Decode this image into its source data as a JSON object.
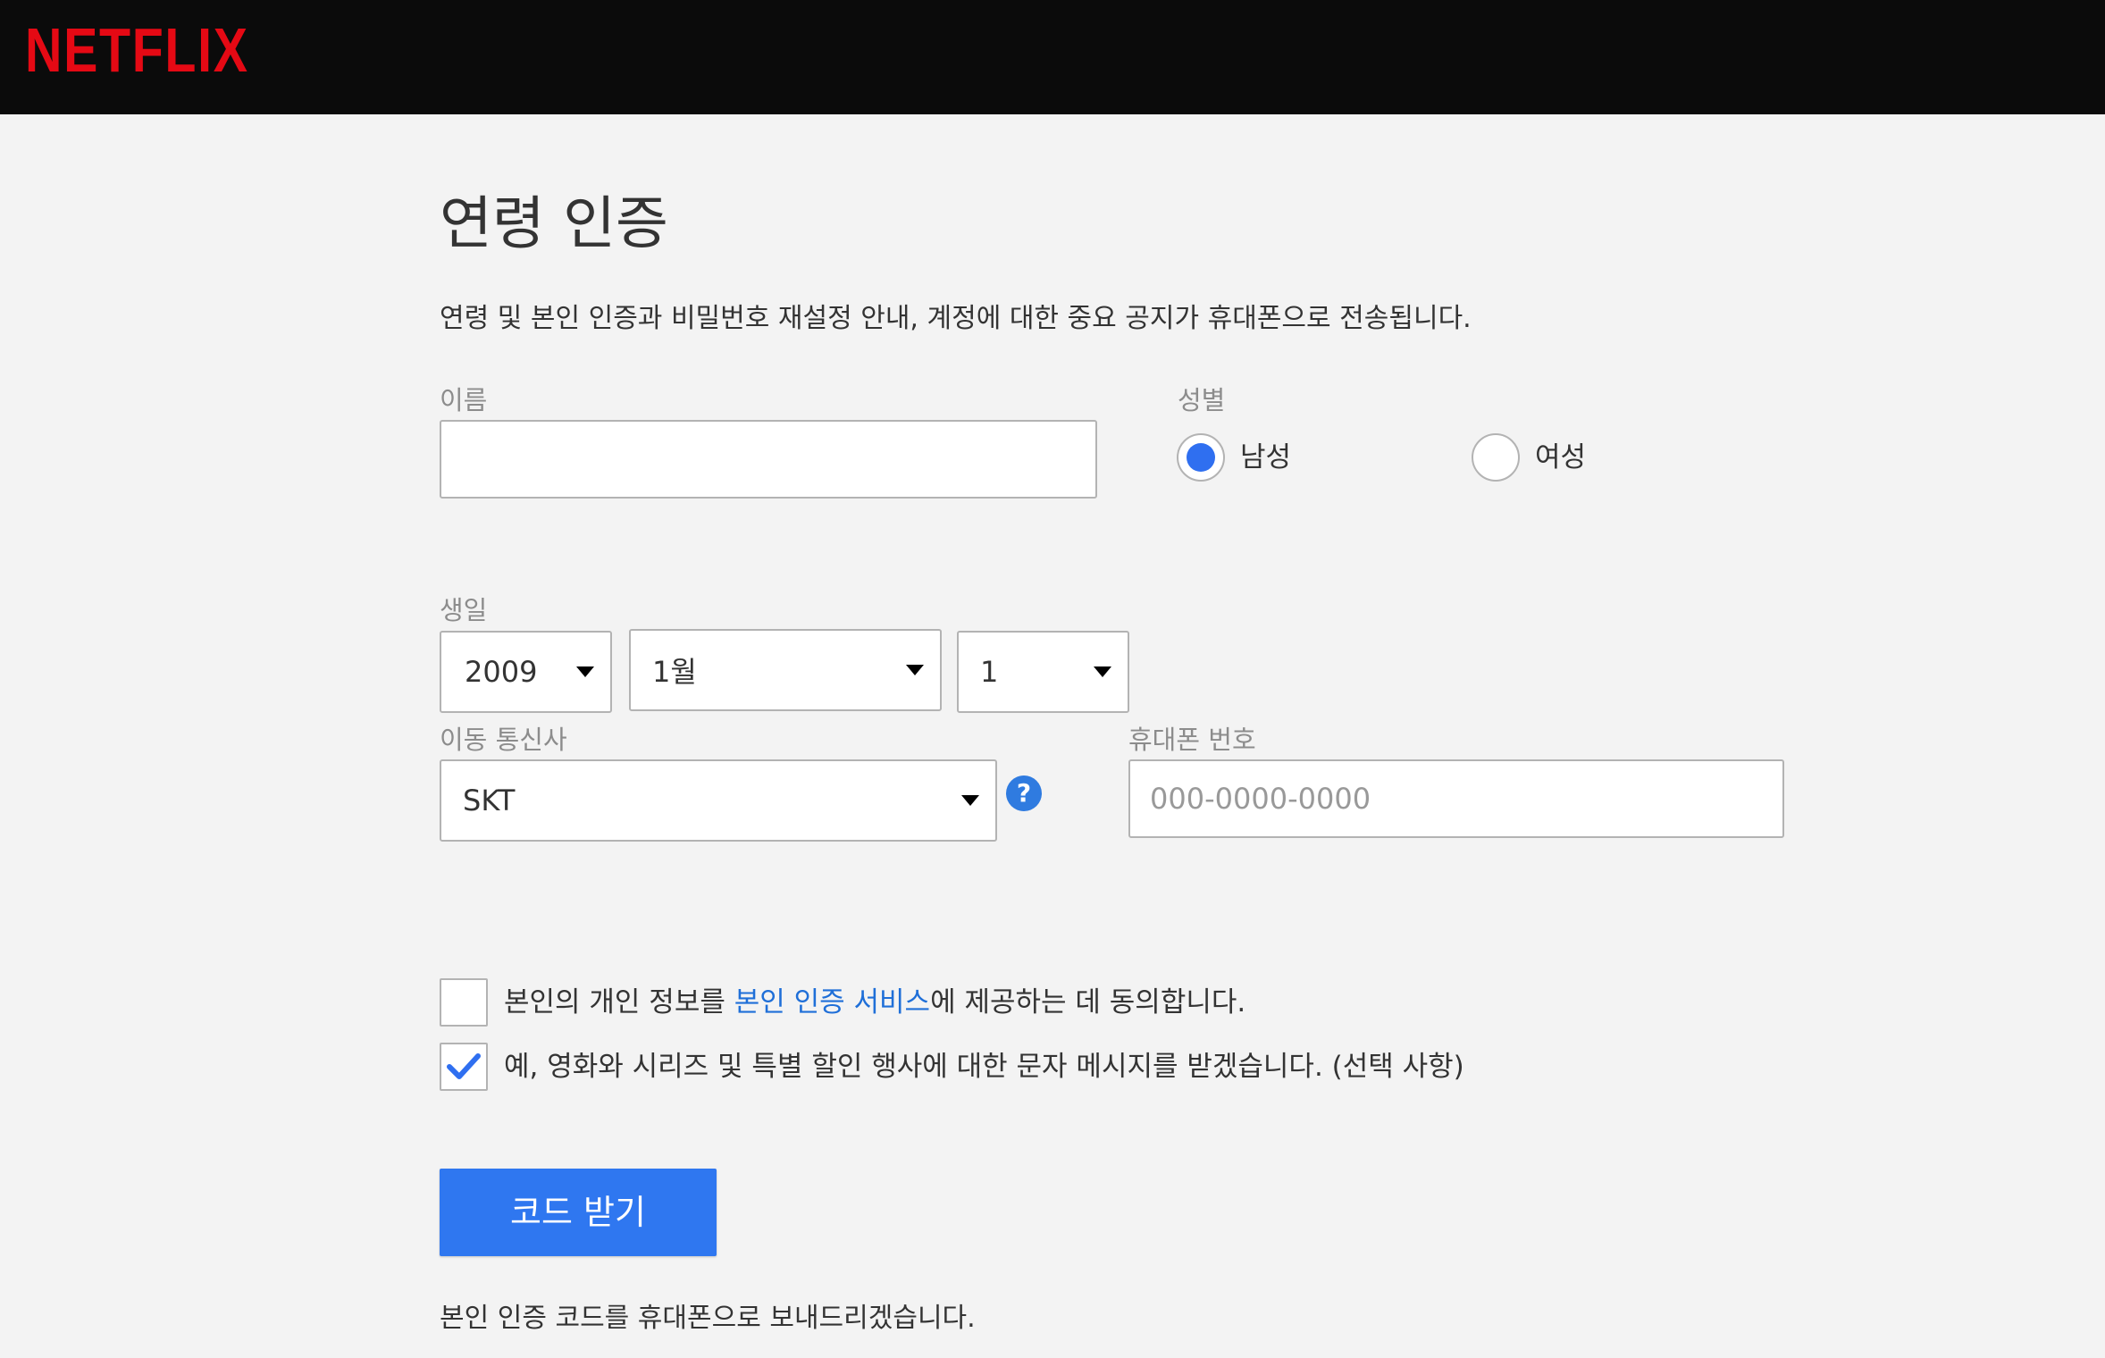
{
  "header": {
    "logo_text": "NETFLIX",
    "brand_color": "#e50914"
  },
  "page": {
    "title": "연령 인증",
    "subtitle": "연령 및 본인 인증과 비밀번호 재설정 안내, 계정에 대한 중요 공지가 휴대폰으로 전송됩니다."
  },
  "form": {
    "name": {
      "label": "이름",
      "value": ""
    },
    "gender": {
      "label": "성별",
      "options": [
        {
          "label": "남성",
          "selected": true
        },
        {
          "label": "여성",
          "selected": false
        }
      ]
    },
    "birthday": {
      "label": "생일",
      "year": "2009",
      "month": "1월",
      "day": "1"
    },
    "carrier": {
      "label": "이동 통신사",
      "value": "SKT",
      "help_icon": "question-icon",
      "help_glyph": "?"
    },
    "phone": {
      "label": "휴대폰 번호",
      "placeholder": "000-0000-0000",
      "value": ""
    }
  },
  "agreements": [
    {
      "checked": false,
      "text_before": "본인의 개인 정보를 ",
      "link_text": "본인 인증 서비스",
      "text_after": "에 제공하는 데 동의합니다."
    },
    {
      "checked": true,
      "text": "예, 영화와 시리즈 및 특별 할인 행사에 대한 문자 메시지를 받겠습니다. (선택 사항)"
    }
  ],
  "submit": {
    "label": "코드 받기",
    "color": "#2f77f0"
  },
  "note": "본인 인증 코드를 휴대폰으로 보내드리겠습니다.",
  "colors": {
    "accent": "#2f6ff0",
    "link": "#1f6fd8",
    "background": "#f3f3f3"
  }
}
